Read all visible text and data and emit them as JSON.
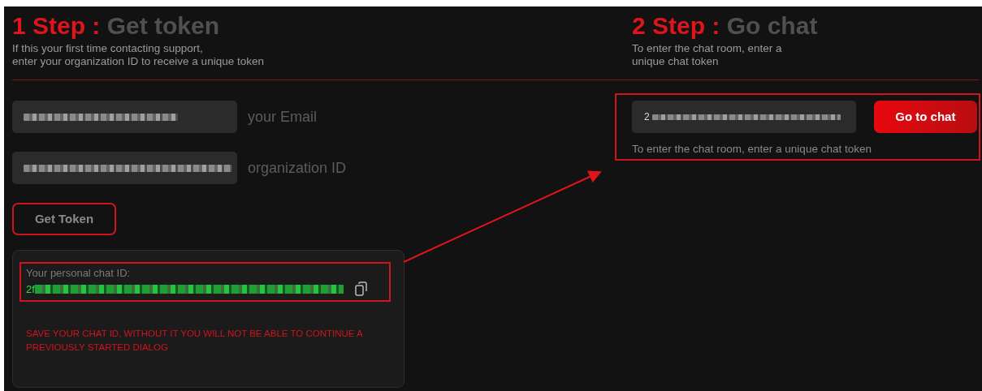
{
  "steps": [
    {
      "number": "1 Step :",
      "title": "Get token",
      "description_lines": [
        "If this your first time contacting support,",
        "enter your organization ID to receive a unique token"
      ]
    },
    {
      "number": "2 Step :",
      "title": "Go chat",
      "description_lines": [
        "To enter the chat room, enter a",
        "unique chat token"
      ]
    }
  ],
  "token_form": {
    "fields": [
      {
        "label": "your Email"
      },
      {
        "label": "organization ID"
      }
    ],
    "button": "Get Token"
  },
  "chat_id_card": {
    "label": "Your personal chat ID:",
    "value_prefix": "2f",
    "warning": "SAVE YOUR CHAT ID, WITHOUT IT YOU WILL NOT BE ABLE TO CONTINUE A PREVIOUSLY STARTED DIALOG"
  },
  "go_chat": {
    "token_prefix": "2",
    "button": "Go to chat",
    "hint": "To enter the chat room, enter a unique chat token"
  }
}
